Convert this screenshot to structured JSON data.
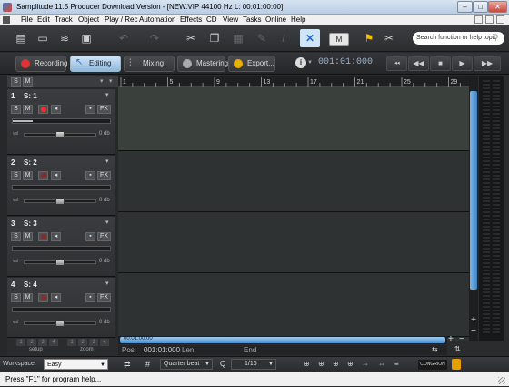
{
  "title_bar": {
    "title": "Samplitude 11.5 Producer Download Version - [NEW.VIP  44100 Hz L: 00:01:00:00]"
  },
  "menu": [
    "File",
    "Edit",
    "Track",
    "Object",
    "Play / Rec",
    "Automation",
    "Effects",
    "CD",
    "View",
    "Tasks",
    "Online",
    "Help"
  ],
  "toolbar": {
    "search_placeholder": "Search function or help topic",
    "m_label": "M"
  },
  "modes": [
    {
      "label": "Recording",
      "active": false,
      "color": "#d33"
    },
    {
      "label": "Editing",
      "active": true,
      "color": "#3a7fd0"
    },
    {
      "label": "Mixing",
      "active": false,
      "color": "#888"
    },
    {
      "label": "Mastering",
      "active": false,
      "color": "#aaa"
    },
    {
      "label": "Export...",
      "active": false,
      "color": "#e8b000"
    }
  ],
  "transport": {
    "timecode": "001:01:000",
    "info_icon": "i"
  },
  "header_sm": {
    "s": "S",
    "m": "M"
  },
  "ruler": [
    "1",
    "5",
    "9",
    "13",
    "17",
    "21",
    "25",
    "29"
  ],
  "tracks": [
    {
      "num": "1",
      "name": "S: 1",
      "db": "0 db",
      "record_armed": true
    },
    {
      "num": "2",
      "name": "S: 2",
      "db": "0 db",
      "record_armed": false
    },
    {
      "num": "3",
      "name": "S: 3",
      "db": "0 db",
      "record_armed": false
    },
    {
      "num": "4",
      "name": "S: 4",
      "db": "0 db",
      "record_armed": false
    }
  ],
  "track_buttons": {
    "s": "S",
    "m": "M",
    "fx": "FX",
    "vol": "vol"
  },
  "bottom": {
    "setup_label": "setup",
    "zoom_label": "zoom",
    "setup_nums": [
      "1",
      "2",
      "3",
      "4"
    ],
    "zoom_nums": [
      "1",
      "2",
      "3",
      "4"
    ],
    "scroll_time": "00:01:00:00",
    "pos_label": "Pos",
    "pos_value": "001:01:000",
    "len_label": "Len",
    "end_label": "End"
  },
  "workspace": {
    "label": "Workspace:",
    "value": "Easy",
    "grid_value": "Quarter beat",
    "q_label": "Q",
    "q_value": "1/16",
    "logo_text": "CONGRION"
  },
  "status": "Press \"F1\" for program help..."
}
